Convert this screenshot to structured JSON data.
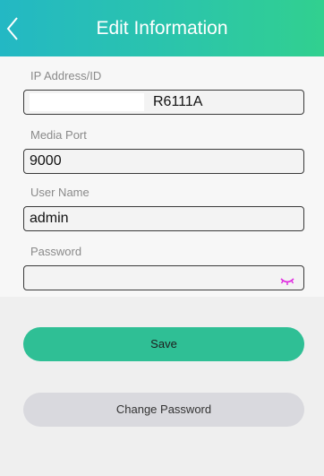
{
  "header": {
    "title": "Edit Information",
    "back_icon": "chevron-left-icon"
  },
  "form": {
    "ip": {
      "label": "IP Address/ID",
      "value": "R6111A"
    },
    "port": {
      "label": "Media Port",
      "value": "9000"
    },
    "user": {
      "label": "User Name",
      "value": "admin"
    },
    "password": {
      "label": "Password",
      "value": "",
      "toggle_icon": "eye-closed-icon"
    }
  },
  "buttons": {
    "save": "Save",
    "change_password": "Change Password"
  },
  "colors": {
    "header_gradient": [
      "#23b8c4",
      "#31d08f"
    ],
    "save_button": "#2fbf95",
    "change_button": "#d9d9de",
    "eye_icon": "#e02be0"
  }
}
